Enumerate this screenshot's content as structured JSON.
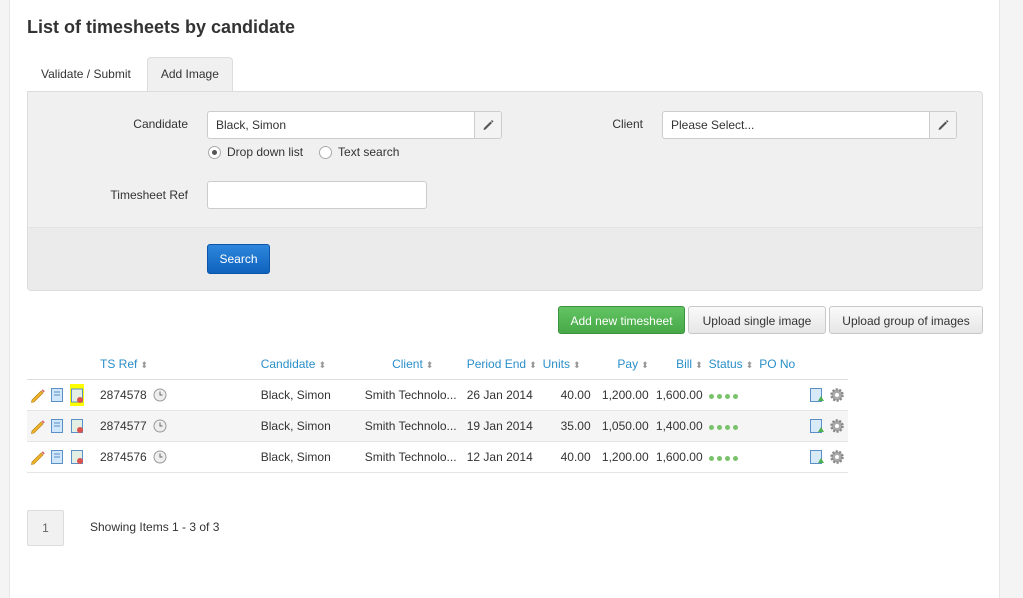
{
  "page": {
    "title": "List of timesheets by candidate"
  },
  "tabs": [
    {
      "label": "Validate / Submit",
      "active": false
    },
    {
      "label": "Add Image",
      "active": true
    }
  ],
  "filters": {
    "candidate_label": "Candidate",
    "candidate_value": "Black, Simon",
    "client_label": "Client",
    "client_value": "Please Select...",
    "radio_dropdown": "Drop down list",
    "radio_text": "Text search",
    "timesheet_ref_label": "Timesheet Ref",
    "timesheet_ref_value": "",
    "search_button": "Search"
  },
  "actions": {
    "add_new": "Add new timesheet",
    "upload_single": "Upload single image",
    "upload_group": "Upload group of images"
  },
  "table": {
    "columns": [
      "TS Ref",
      "Candidate",
      "Client",
      "Period End",
      "Units",
      "Pay",
      "Bill",
      "Status",
      "PO No"
    ],
    "rows": [
      {
        "ts_ref": "2874578",
        "candidate": "Black, Simon",
        "client": "Smith Technolo...",
        "period_end": "26 Jan 2014",
        "units": "40.00",
        "pay": "1,200.00",
        "bill": "1,600.00",
        "po_no": ""
      },
      {
        "ts_ref": "2874577",
        "candidate": "Black, Simon",
        "client": "Smith Technolo...",
        "period_end": "19 Jan 2014",
        "units": "35.00",
        "pay": "1,050.00",
        "bill": "1,400.00",
        "po_no": ""
      },
      {
        "ts_ref": "2874576",
        "candidate": "Black, Simon",
        "client": "Smith Technolo...",
        "period_end": "12 Jan 2014",
        "units": "40.00",
        "pay": "1,200.00",
        "bill": "1,600.00",
        "po_no": ""
      }
    ]
  },
  "pager": {
    "current_page": "1",
    "summary": "Showing Items 1 - 3 of 3"
  },
  "colors": {
    "primary": "#0f63bd",
    "success": "#46a846",
    "link": "#2a8ec8",
    "status_dot": "#79c26a",
    "highlight": "#ffff00"
  },
  "icons": {
    "row_actions": [
      "pencil-icon",
      "document-icon",
      "document-image-icon"
    ],
    "row_right": [
      "upload-image-icon",
      "gear-icon"
    ],
    "clock": "clock-icon"
  }
}
